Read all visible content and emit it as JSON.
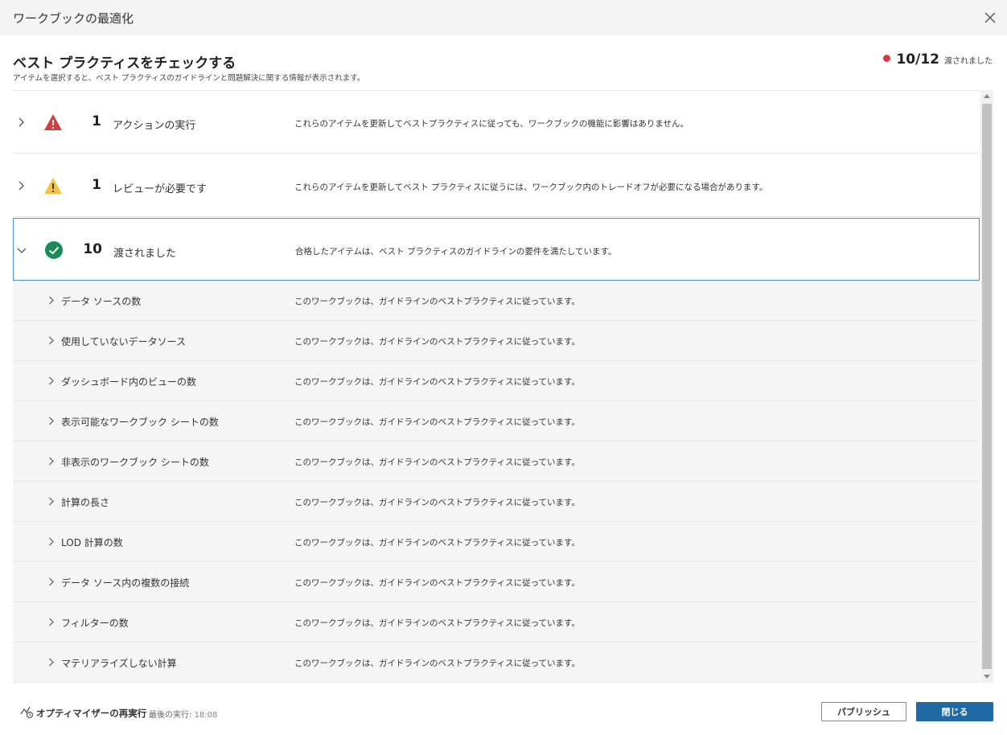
{
  "window": {
    "title": "ワークブックの最適化"
  },
  "header": {
    "title": "ベスト プラクティスをチェックする",
    "subtitle": "アイテムを選択すると、ベスト プラクティスのガイドラインと問題解決に関する情報が表示されます。",
    "score": "10/12",
    "score_label": "渡されました",
    "score_color": "#d13d41"
  },
  "groups": [
    {
      "count": "1",
      "label": "アクションの実行",
      "description": "これらのアイテムを更新してベストプラクティスに従っても、ワークブックの機能に影響はありません。",
      "icon": "error-triangle-icon",
      "color": "#d13d41",
      "expanded": false
    },
    {
      "count": "1",
      "label": "レビューが必要です",
      "description": "これらのアイテムを更新してベスト プラクティスに従うには、ワークブック内のトレードオフが必要になる場合があります。",
      "icon": "warning-triangle-icon",
      "color": "#f5c242",
      "expanded": false
    },
    {
      "count": "10",
      "label": "渡されました",
      "description": "合格したアイテムは、ベスト プラクティスのガイドラインの要件を満たしています。",
      "icon": "check-circle-icon",
      "color": "#1a8c5b",
      "expanded": true
    }
  ],
  "passed_items": [
    {
      "label": "データ ソースの数",
      "description": "このワークブックは、ガイドラインのベストプラクティスに従っています。"
    },
    {
      "label": "使用していないデータソース",
      "description": "このワークブックは、ガイドラインのベストプラクティスに従っています。"
    },
    {
      "label": "ダッシュボード内のビューの数",
      "description": "このワークブックは、ガイドラインのベストプラクティスに従っています。"
    },
    {
      "label": "表示可能なワークブック シートの数",
      "description": "このワークブックは、ガイドラインのベストプラクティスに従っています。"
    },
    {
      "label": "非表示のワークブック シートの数",
      "description": "このワークブックは、ガイドラインのベストプラクティスに従っています。"
    },
    {
      "label": "計算の長さ",
      "description": "このワークブックは、ガイドラインのベストプラクティスに従っています。"
    },
    {
      "label": "LOD 計算の数",
      "description": "このワークブックは、ガイドラインのベストプラクティスに従っています。"
    },
    {
      "label": "データ ソース内の複数の接続",
      "description": "このワークブックは、ガイドラインのベストプラクティスに従っています。"
    },
    {
      "label": "フィルターの数",
      "description": "このワークブックは、ガイドラインのベストプラクティスに従っています。"
    },
    {
      "label": "マテリアライズしない計算",
      "description": "このワークブックは、ガイドラインのベストプラクティスに従っています。"
    }
  ],
  "footer": {
    "rerun_label": "オプティマイザーの再実行",
    "last_run_label": "最後の実行:",
    "last_run_time": "18:08",
    "publish_label": "パブリッシュ",
    "close_label": "閉じる",
    "primary_color": "#1f6aa5"
  }
}
